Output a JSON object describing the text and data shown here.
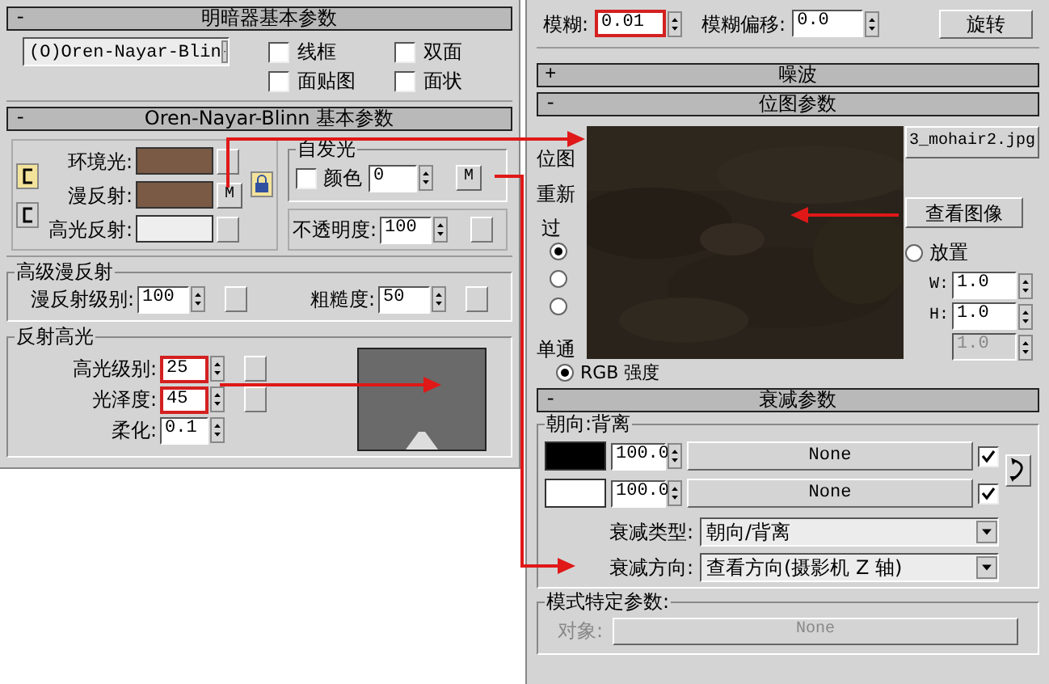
{
  "left_panel": {
    "shader_rollout": {
      "collapse": "-",
      "title": "明暗器基本参数",
      "shader": "(O)Oren-Nayar-Blin",
      "options": [
        {
          "label": "线框",
          "checked": false
        },
        {
          "label": "双面",
          "checked": false
        },
        {
          "label": "面贴图",
          "checked": false
        },
        {
          "label": "面状",
          "checked": false
        }
      ]
    },
    "basic_rollout": {
      "collapse": "-",
      "title": "Oren-Nayar-Blinn 基本参数",
      "colors": [
        {
          "label": "环境光:",
          "color": "#7a5a45"
        },
        {
          "label": "漫反射:",
          "color": "#7a5a45",
          "map_button": "M"
        },
        {
          "label": "高光反射:",
          "color": "#eeeeee"
        }
      ],
      "self_illum": {
        "title": "自发光",
        "checkbox": {
          "label": "颜色",
          "checked": false
        },
        "value": "0",
        "map_button": "M"
      },
      "opacity": {
        "label": "不透明度:",
        "value": "100"
      },
      "advanced_diffuse": {
        "title": "高级漫反射",
        "fields": [
          {
            "label": "漫反射级别:",
            "value": "100"
          },
          {
            "label": "粗糙度:",
            "value": "50"
          }
        ]
      },
      "specular": {
        "title": "反射高光",
        "fields": [
          {
            "label": "高光级别:",
            "value": "25",
            "highlighted": true
          },
          {
            "label": "光泽度:",
            "value": "45",
            "highlighted": true
          },
          {
            "label": "柔化:",
            "value": "0.1",
            "highlighted": false
          }
        ]
      }
    }
  },
  "right_panel": {
    "blur": {
      "label": "模糊:",
      "value": "0.01",
      "highlighted": true
    },
    "blur_offset": {
      "label": "模糊偏移:",
      "value": "0.0",
      "highlighted": false
    },
    "rotate_button": "旋转",
    "rollouts": [
      {
        "collapse": "+",
        "title": "噪波"
      },
      {
        "collapse": "-",
        "title": "位图参数"
      }
    ],
    "bitmap": {
      "label": "位图",
      "file": "3_mohair2.jpg",
      "reload": "重新",
      "filter_group": "过",
      "filter_radios": [
        {
          "selected": true
        },
        {
          "selected": false
        },
        {
          "selected": false
        }
      ],
      "view_image": "查看图像",
      "place": {
        "label": "放置",
        "selected": false
      },
      "w": {
        "label": "W:",
        "value": "1.0"
      },
      "h": {
        "label": "H:",
        "value": "1.0"
      },
      "third": {
        "value": "1.0",
        "disabled": true
      },
      "channel_group": "单通",
      "channel_radio": {
        "label": "RGB 强度",
        "selected": true
      }
    },
    "falloff": {
      "collapse": "-",
      "title": "衰减参数",
      "group": "朝向:背离",
      "slots": [
        {
          "color": "#000000",
          "value": "100.0",
          "map": "None",
          "checked": true
        },
        {
          "color": "#ffffff",
          "value": "100.0",
          "map": "None",
          "checked": true
        }
      ],
      "type": {
        "label": "衰减类型:",
        "value": "朝向/背离"
      },
      "direction": {
        "label": "衰减方向:",
        "value": "查看方向(摄影机 Z 轴)"
      },
      "mode_group": "模式特定参数:",
      "object": {
        "label": "对象:",
        "value": "None",
        "disabled": true
      }
    }
  }
}
